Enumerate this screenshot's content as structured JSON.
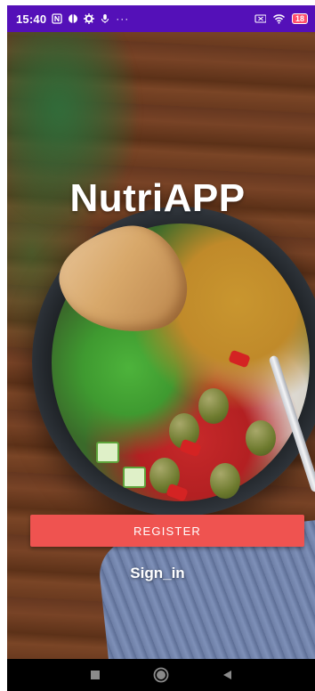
{
  "status_bar": {
    "time": "15:40",
    "notification_icons": [
      "nfc-icon",
      "app-icon",
      "gear-icon",
      "mic-icon"
    ],
    "more_indicator": "···",
    "battery_level": "18",
    "colors": {
      "background": "#5410b8",
      "battery": "#ff4d6b"
    }
  },
  "app": {
    "title": "NutriAPP",
    "register_label": "REGISTER",
    "sign_in_label": "Sign_in",
    "colors": {
      "register_button": "#ef5350",
      "title_text": "#ffffff"
    }
  },
  "nav_bar": {
    "buttons": [
      "recents-square-icon",
      "home-circle-icon",
      "back-triangle-icon"
    ]
  }
}
